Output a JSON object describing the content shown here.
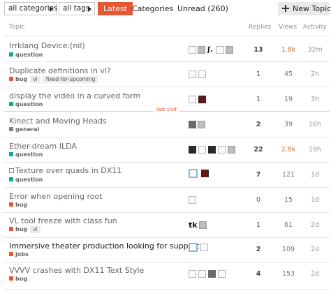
{
  "filters": {
    "categories": "all categories",
    "tags": "all tags"
  },
  "nav": {
    "latest": "Latest",
    "categories": "Categories",
    "unread": "Unread (260)"
  },
  "new_topic": "New Topic",
  "columns": {
    "topic": "Topic",
    "replies": "Replies",
    "views": "Views",
    "activity": "Activity"
  },
  "last_visit": "last visit",
  "category_colors": {
    "question": "#12a89d",
    "bug": "#e45735",
    "general": "#808281",
    "jobs": "#f1592a"
  },
  "accent": "#e45735",
  "topics": [
    {
      "title": "Irrklang Device:(nil)",
      "category": "question",
      "tags": [],
      "replies": "13",
      "views": "1.8k",
      "activity": "32m"
    },
    {
      "title": "Duplicate definitions in vl?",
      "category": "bug",
      "tags": [
        "vl",
        "fixed-for-upcoming"
      ],
      "replies": "1",
      "views": "45",
      "activity": "2h"
    },
    {
      "title": "display the video in a curved form",
      "category": "question",
      "tags": [],
      "replies": "1",
      "views": "19",
      "activity": "3h"
    },
    {
      "title": "Kinect and Moving Heads",
      "category": "general",
      "tags": [],
      "replies": "2",
      "views": "39",
      "activity": "16h"
    },
    {
      "title": "Ether-dream ILDA",
      "category": "question",
      "tags": [],
      "replies": "22",
      "views": "2.8k",
      "activity": "19h"
    },
    {
      "title": "Texture over quads in DX11",
      "category": "question",
      "tags": [],
      "replies": "7",
      "views": "121",
      "activity": "1d"
    },
    {
      "title": "Error when opening root",
      "category": "bug",
      "tags": [],
      "replies": "0",
      "views": "15",
      "activity": "1d"
    },
    {
      "title": "VL tool freeze with class fun",
      "category": "bug",
      "tags": [
        "vl"
      ],
      "replies": "1",
      "views": "61",
      "activity": "2d"
    },
    {
      "title": "Immersive theater production looking for support",
      "category": "jobs",
      "tags": [],
      "replies": "2",
      "views": "109",
      "activity": "2d"
    },
    {
      "title": "VVVV crashes with DX11 Text Style",
      "category": "bug",
      "tags": [],
      "replies": "4",
      "views": "153",
      "activity": "2d"
    }
  ]
}
